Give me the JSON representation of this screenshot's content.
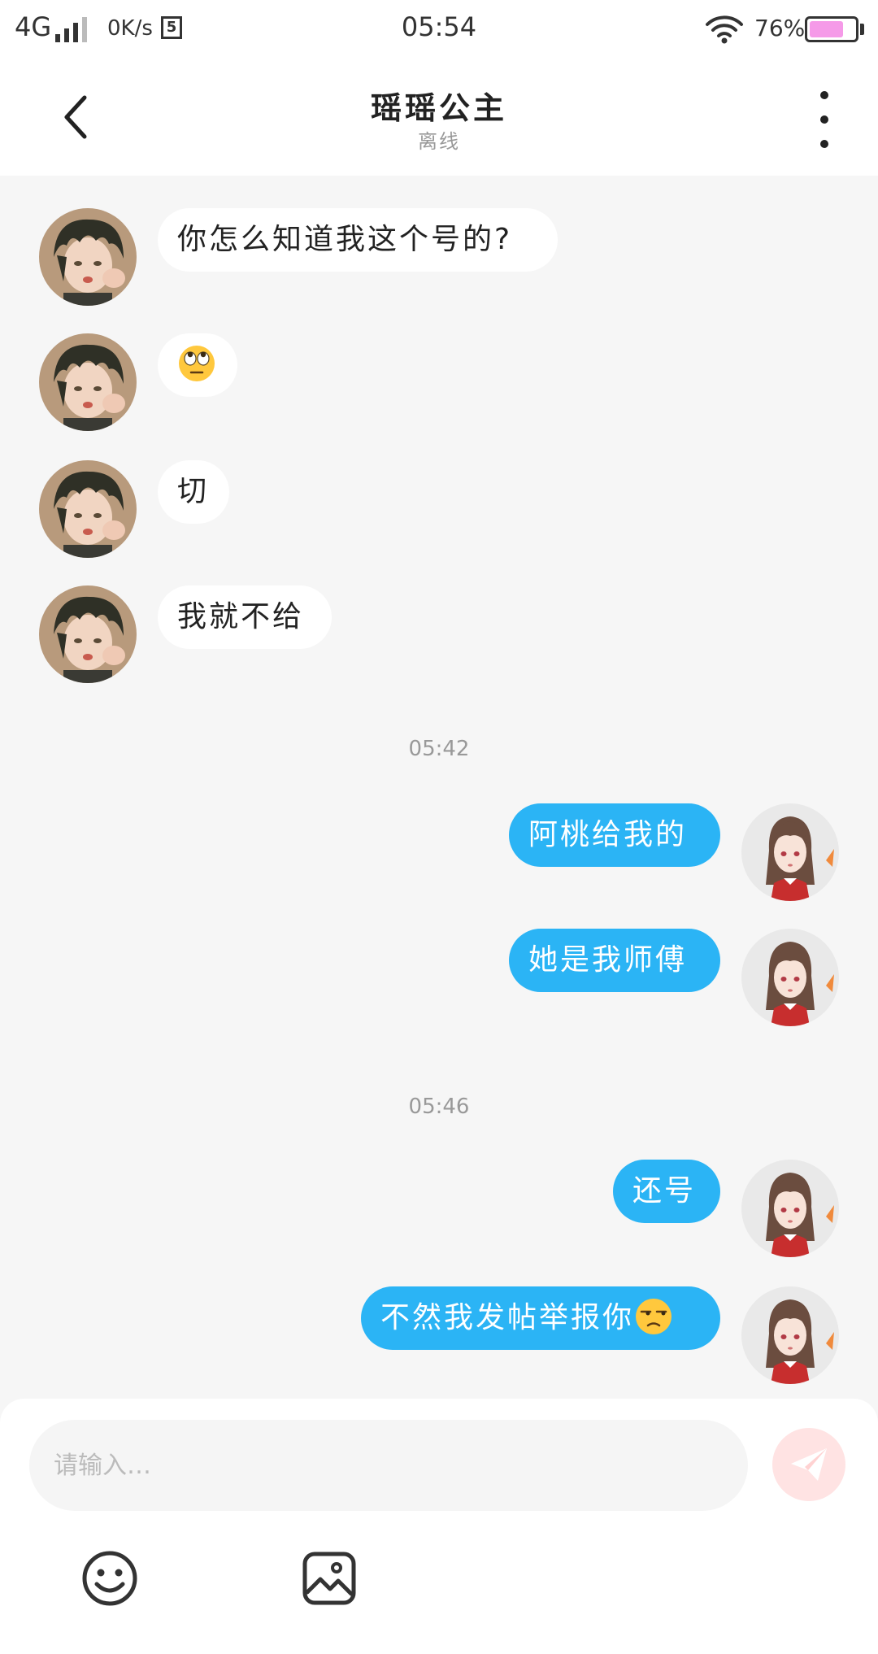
{
  "status_bar": {
    "network": "4G",
    "speed": "0K/s",
    "sim_icon": "sim-card-icon",
    "time": "05:54",
    "battery_percent": "76%",
    "battery_level": 0.76
  },
  "header": {
    "back_icon": "chevron-left-icon",
    "title": "瑶瑶公主",
    "subtitle": "离线",
    "more_icon": "more-vertical-icon"
  },
  "messages": [
    {
      "side": "in",
      "text": "你怎么知道我这个号的?"
    },
    {
      "side": "in",
      "emoji": "face-with-rolling-eyes"
    },
    {
      "side": "in",
      "text": "切"
    },
    {
      "side": "in",
      "text": "我就不给"
    },
    {
      "timestamp": "05:42"
    },
    {
      "side": "out",
      "text": "阿桃给我的"
    },
    {
      "side": "out",
      "text": "她是我师傅"
    },
    {
      "timestamp": "05:46"
    },
    {
      "side": "out",
      "text": "还号"
    },
    {
      "side": "out",
      "text": "不然我发帖举报你",
      "emoji": "unamused-face"
    }
  ],
  "composer": {
    "placeholder": "请输入…",
    "value": "",
    "send_icon": "paper-plane-icon",
    "emoji_icon": "smiley-icon",
    "image_icon": "image-icon"
  },
  "colors": {
    "outgoing_bubble": "#2bb4f5",
    "incoming_bubble": "#ffffff",
    "background": "#f6f6f6",
    "battery_fill": "#f59ae8",
    "send_button": "#ffe3e3"
  }
}
